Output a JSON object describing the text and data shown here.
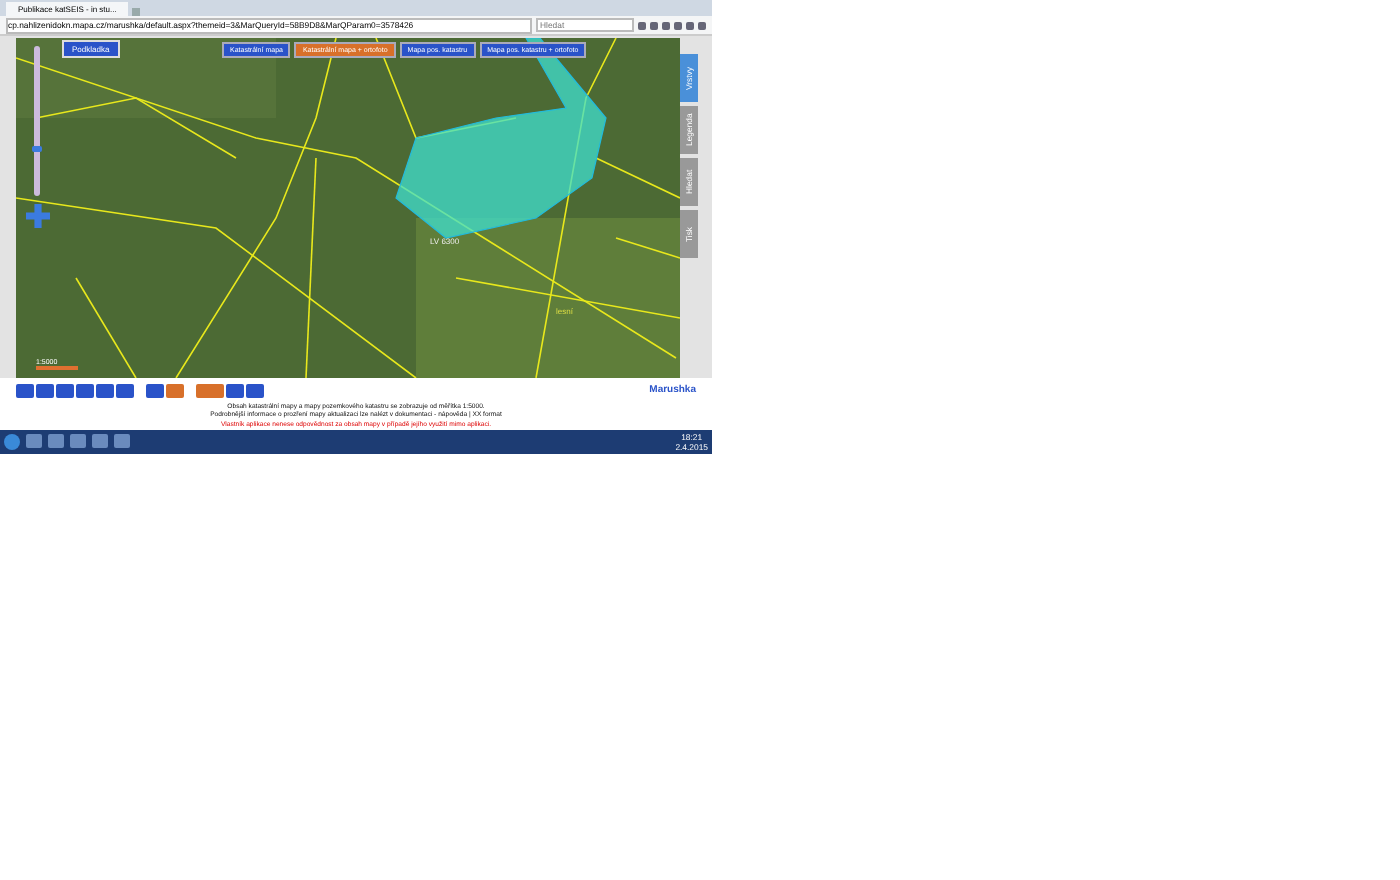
{
  "browser": {
    "tab_title": "Publikace katSEIS - in stu...",
    "address": "cp.nahlizenidokn.mapa.cz/marushka/default.aspx?themeid=3&MarQueryId=58B9D8&MarQParam0=3578426",
    "search_placeholder": "Hledat"
  },
  "map": {
    "base_button": "Podkladka",
    "layer_buttons": [
      {
        "label": "Katastrální mapa",
        "selected": false
      },
      {
        "label": "Katastrální mapa + ortofoto",
        "selected": true
      },
      {
        "label": "Mapa pos. katastru",
        "selected": false
      },
      {
        "label": "Mapa pos. katastru + ortofoto",
        "selected": false
      }
    ],
    "side_tabs": [
      {
        "label": "Vrstvy",
        "selected": true
      },
      {
        "label": "Legenda",
        "selected": false
      },
      {
        "label": "Hledat",
        "selected": false
      },
      {
        "label": "Tisk",
        "selected": false
      }
    ],
    "zoom_slider": {
      "level": 0.3
    },
    "parcel_label": "LV 6300",
    "field_label": "lesní",
    "scale_label": "1:5000"
  },
  "logo": "Marushka",
  "footer": {
    "lines": [
      {
        "text": "Obsah katastrální mapy a mapy pozemkového katastru se zobrazuje od měřítka 1:5000.",
        "kind": "normal"
      },
      {
        "text": "Podrobnější informace o prozření mapy aktualizaci lze nalézt v dokumentaci - nápověda | XX format",
        "kind": "normal"
      },
      {
        "text": "Vlastník aplikace nenese odpovědnost za obsah mapy v případě jejího využití mimo aplikaci.",
        "kind": "warning"
      }
    ]
  },
  "taskbar": {
    "time": "18:21",
    "date": "2.4.2015"
  }
}
